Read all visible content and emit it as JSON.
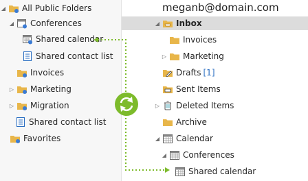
{
  "account": "meganb@domain.com",
  "colors": {
    "sync": "#7dbb2b",
    "folder": "#e8b64a",
    "accent": "#2a6ec2",
    "highlight": "#dcdcdc"
  },
  "public_folders": {
    "root": "All Public Folders",
    "conferences": "Conferences",
    "shared_calendar": "Shared calendar",
    "shared_contact_list_sub": "Shared contact list",
    "invoices": "Invoices",
    "marketing": "Marketing",
    "migration": "Migration",
    "shared_contact_list": "Shared contact list",
    "favorites": "Favorites"
  },
  "mailbox": {
    "inbox": "Inbox",
    "invoices": "Invoices",
    "marketing": "Marketing",
    "drafts": "Drafts",
    "drafts_count": "[1]",
    "sent_items": "Sent Items",
    "deleted_items": "Deleted Items",
    "archive": "Archive",
    "calendar": "Calendar",
    "conferences": "Conferences",
    "shared_calendar": "Shared calendar"
  }
}
